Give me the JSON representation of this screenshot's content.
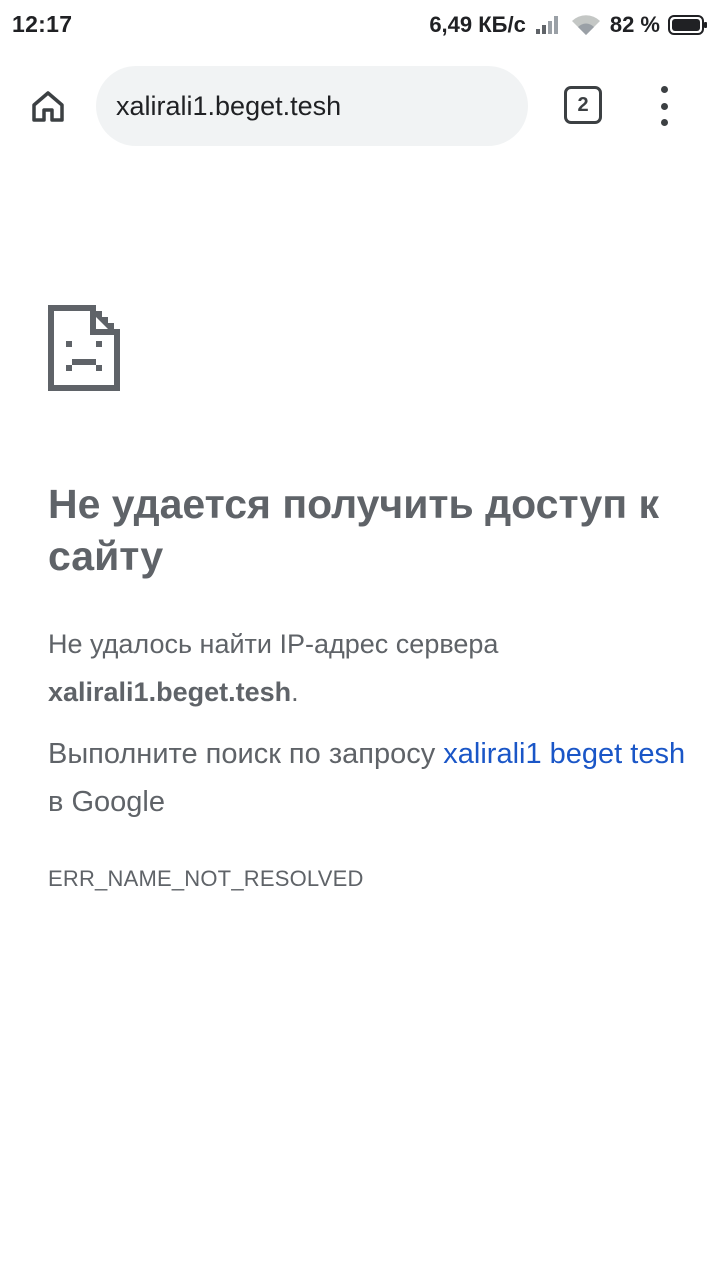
{
  "status_bar": {
    "time": "12:17",
    "network_speed": "6,49 КБ/с",
    "battery_percent": "82 %",
    "icons": [
      "signal-icon",
      "wifi-icon",
      "battery-icon"
    ]
  },
  "toolbar": {
    "url": "xalirali1.beget.tesh",
    "tab_count": "2",
    "icons": [
      "home-icon",
      "tabs-icon",
      "more-vert-icon"
    ]
  },
  "error": {
    "icon": "sad-page-icon",
    "title": "Не удается получить доступ к сайту",
    "description_prefix": "Не удалось найти IP-адрес сервера ",
    "host": "xalirali1.beget.tesh",
    "description_suffix": ".",
    "suggest_prefix": "Выполните поиск по запросу ",
    "search_query": "xalirali1 beget tesh",
    "suggest_suffix": " в Google",
    "code": "ERR_NAME_NOT_RESOLVED"
  },
  "colors": {
    "text_gray": "#5f6368",
    "link_blue": "#1a56c7",
    "omnibox_bg": "#f1f3f4"
  }
}
